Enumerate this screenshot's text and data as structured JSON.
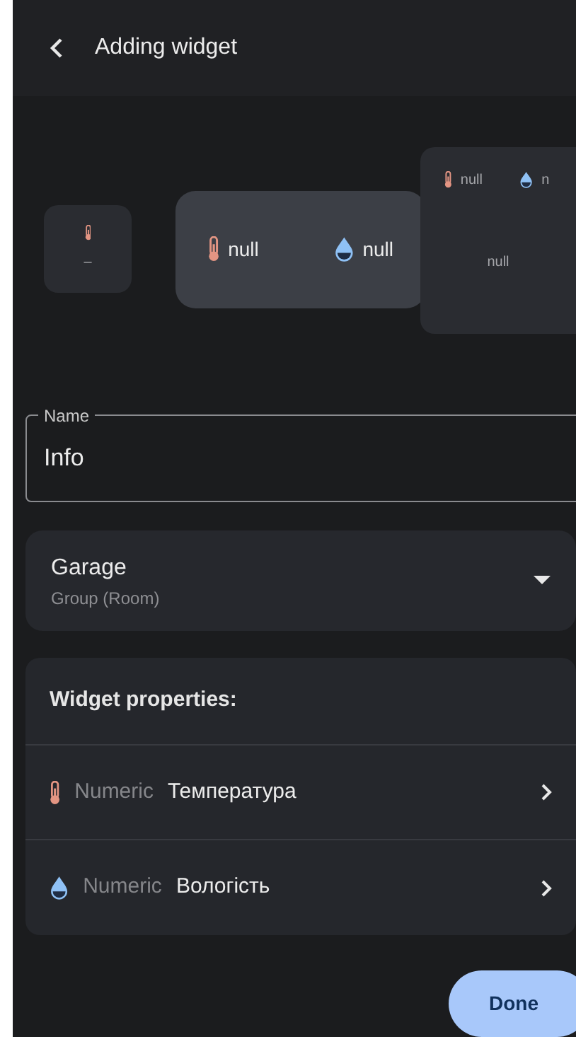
{
  "header": {
    "title": "Adding widget"
  },
  "previews": [
    {
      "kind": "small",
      "selected": false,
      "values": [
        {
          "kind": "temperature",
          "text": "–"
        }
      ]
    },
    {
      "kind": "wide",
      "selected": true,
      "values": [
        {
          "kind": "temperature",
          "text": "null"
        },
        {
          "kind": "humidity",
          "text": "null"
        }
      ]
    },
    {
      "kind": "large",
      "selected": false,
      "values": [
        {
          "kind": "temperature",
          "text": "null"
        },
        {
          "kind": "humidity",
          "text": "n"
        }
      ],
      "footer": "null"
    }
  ],
  "name_field": {
    "label": "Name",
    "value": "Info"
  },
  "group_select": {
    "value": "Garage",
    "subtitle": "Group (Room)"
  },
  "properties": {
    "title": "Widget properties:",
    "items": [
      {
        "kind": "temperature",
        "type": "Numeric",
        "name": "Температура"
      },
      {
        "kind": "humidity",
        "type": "Numeric",
        "name": "Вологість"
      }
    ]
  },
  "done_button": "Done"
}
